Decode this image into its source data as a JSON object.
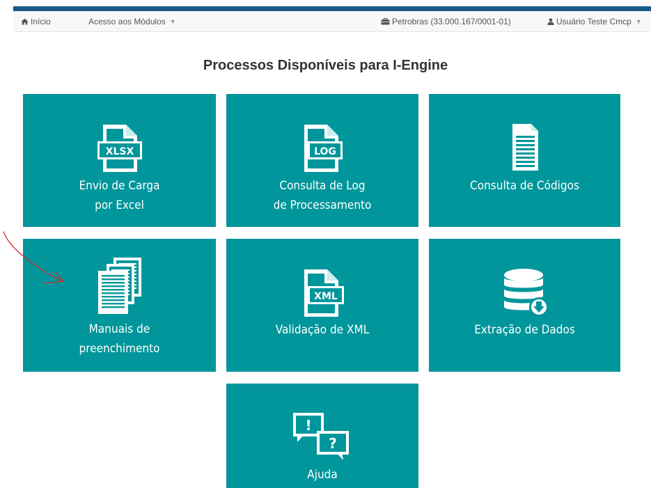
{
  "navbar": {
    "home_label": "Início",
    "modules_label": "Acesso aos Módulos",
    "company_label": "Petrobras (33.000.167/0001-01)",
    "user_label": "Usuário Teste Cmcp"
  },
  "page": {
    "title": "Processos Disponíveis para I-Engine"
  },
  "tiles": [
    {
      "line1": "Envio de Carga",
      "line2": "por Excel",
      "icon": "xlsx-file-icon",
      "badge": "XLSX"
    },
    {
      "line1": "Consulta de Log",
      "line2": "de Processamento",
      "icon": "log-file-icon",
      "badge": "LOG"
    },
    {
      "line1": "Consulta de Códigos",
      "icon": "document-icon"
    },
    {
      "line1": "Manuais de",
      "line2": "preenchimento",
      "icon": "documents-stack-icon"
    },
    {
      "line1": "Validação de XML",
      "icon": "xml-file-icon",
      "badge": "XML"
    },
    {
      "line1": "Extração de Dados",
      "icon": "database-download-icon"
    },
    {
      "line1": "Ajuda",
      "icon": "help-chat-icon",
      "badge1": "!",
      "badge2": "?"
    }
  ],
  "colors": {
    "tile": "#00969b",
    "accent": "#1a5a87",
    "annotation": "#d42a2a"
  }
}
